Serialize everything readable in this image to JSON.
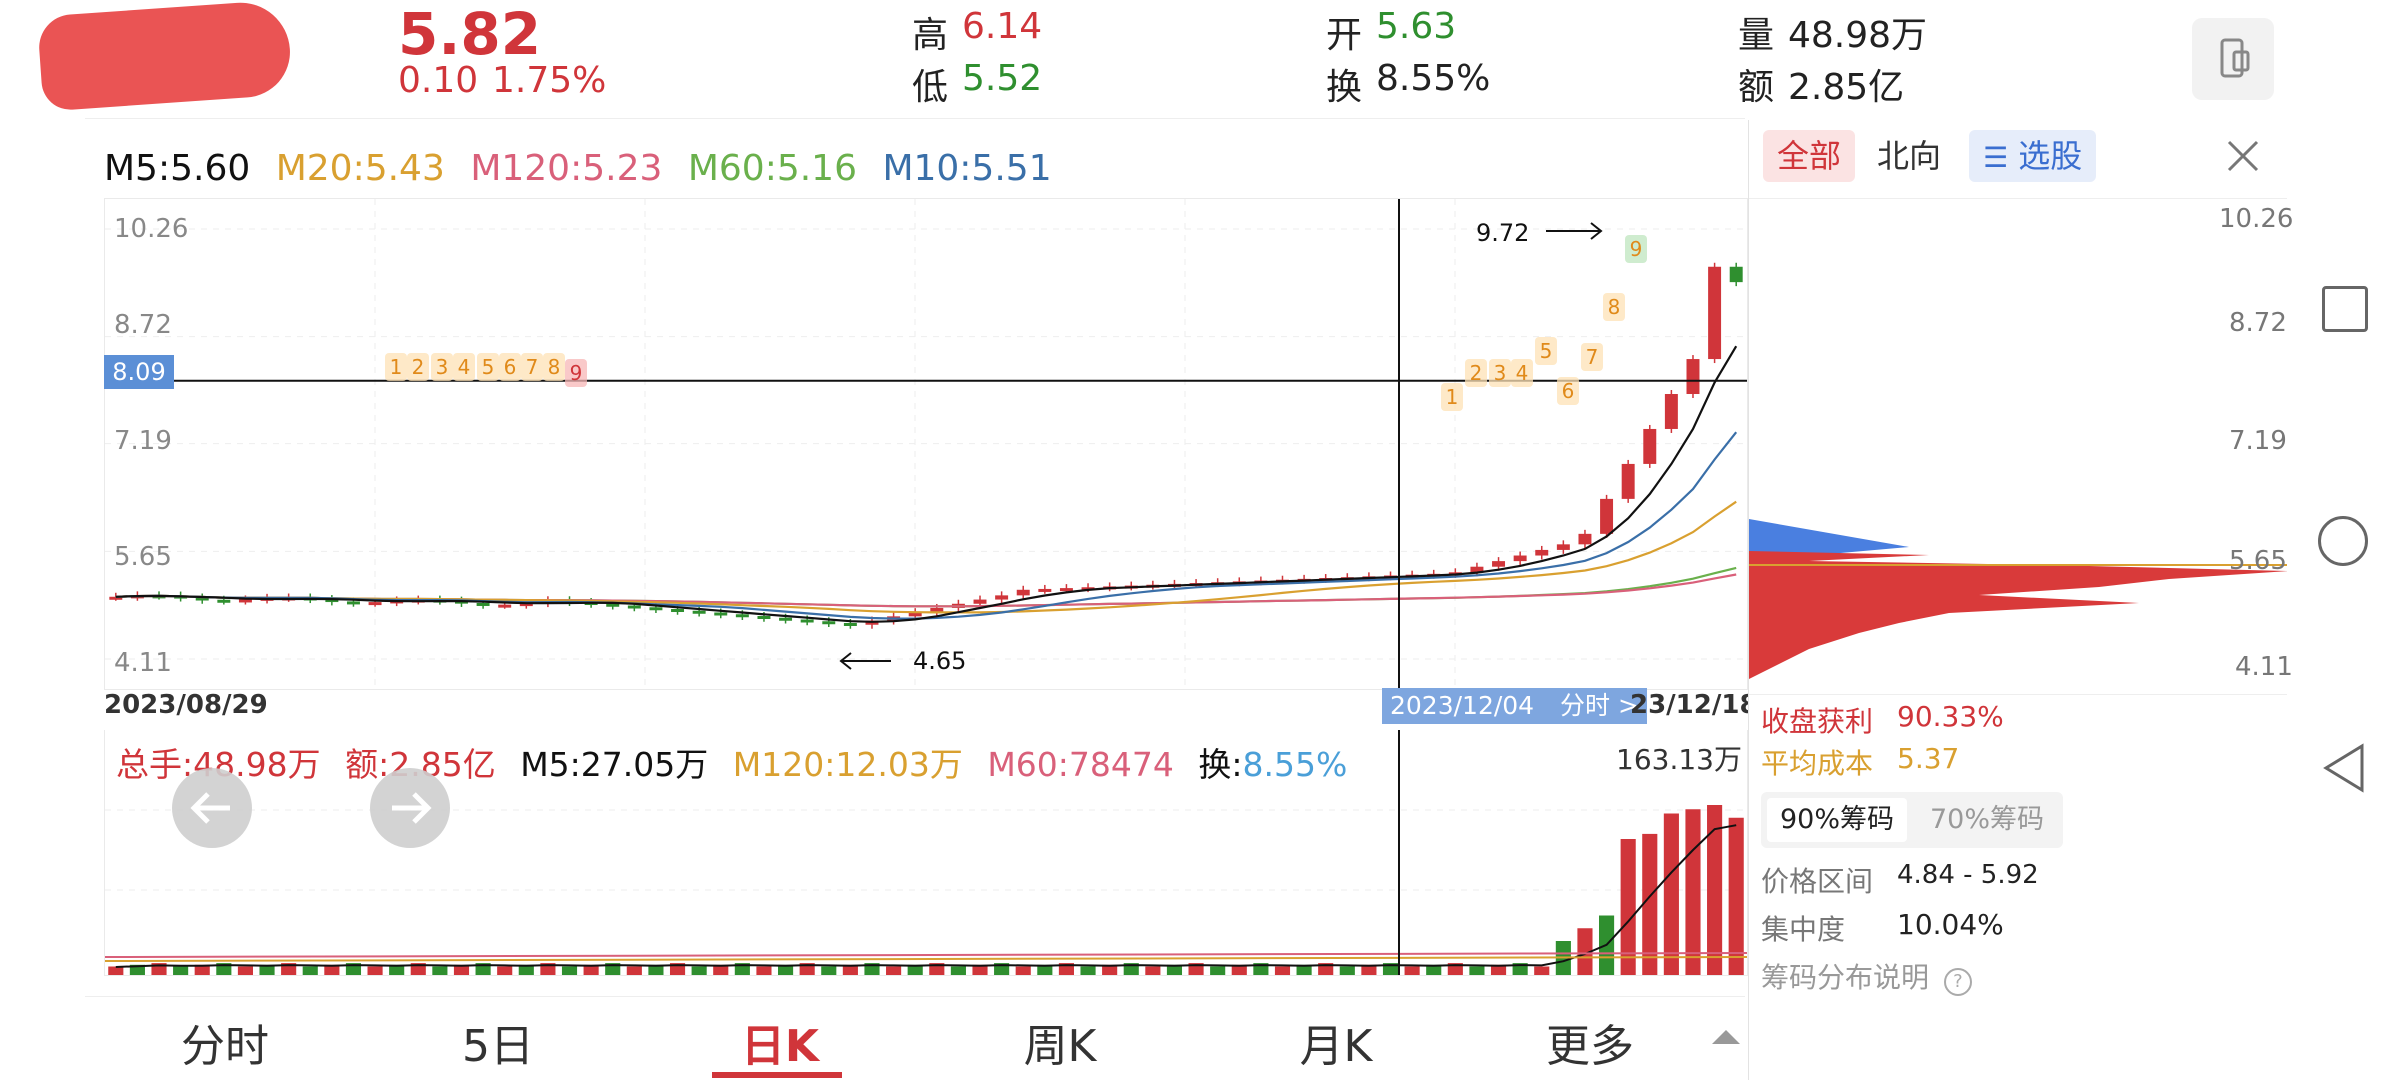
{
  "header": {
    "price": "5.82",
    "change": "0.10",
    "change_pct": "1.75%",
    "high_label": "高",
    "high": "6.14",
    "low_label": "低",
    "low": "5.52",
    "open_label": "开",
    "open": "5.63",
    "turnover_label": "换",
    "turnover": "8.55%",
    "volume_label": "量",
    "volume": "48.98万",
    "amount_label": "额",
    "amount": "2.85亿"
  },
  "ma_legend": {
    "m5": "M5:5.60",
    "m20": "M20:5.43",
    "m120": "M120:5.23",
    "m60": "M60:5.16",
    "m10": "M10:5.51"
  },
  "price_axis": [
    "10.26",
    "8.72",
    "7.19",
    "5.65",
    "4.11"
  ],
  "crosshair_price": "8.09",
  "date_start": "2023/08/29",
  "date_cursor": "2023/12/04",
  "cursor_link": "分时 >",
  "date_end": "23/12/18",
  "annotations": {
    "high_mark": "9.72",
    "low_mark": "4.65"
  },
  "volume_legend": {
    "total": "总手:48.98万",
    "amount": "额:2.85亿",
    "m5": "M5:27.05万",
    "m120": "M120:12.03万",
    "m60": "M60:78474",
    "turn_label": "换:",
    "turn_value": "8.55%",
    "max_label": "163.13万"
  },
  "bottom_tabs": [
    "分时",
    "5日",
    "日K",
    "周K",
    "月K",
    "更多"
  ],
  "active_tab": "日K",
  "chips_panel": {
    "tabs": [
      "全部",
      "北向",
      "选股"
    ],
    "axis": [
      "10.26",
      "8.72",
      "7.19",
      "5.65",
      "4.11"
    ],
    "profit_label": "收盘获利",
    "profit_value": "90.33%",
    "cost_label": "平均成本",
    "cost_value": "5.37",
    "chip_tabs": [
      "90%筹码",
      "70%筹码"
    ],
    "range_label": "价格区间",
    "range_value": "4.84 - 5.92",
    "conc_label": "集中度",
    "conc_value": "10.04%",
    "explain_label": "筹码分布说明"
  },
  "seq_markers_left": [
    "1",
    "2",
    "3",
    "4",
    "5",
    "6",
    "7",
    "8",
    "9"
  ],
  "seq_markers_right": [
    "1",
    "2",
    "3",
    "4",
    "5",
    "6",
    "7",
    "8",
    "9"
  ],
  "colors": {
    "up": "#d0353a",
    "down": "#2f8f2f",
    "m5": "#111111",
    "m10": "#3a6fa8",
    "m20": "#d9a030",
    "m60": "#6ab04c",
    "m120": "#d9607a"
  }
}
